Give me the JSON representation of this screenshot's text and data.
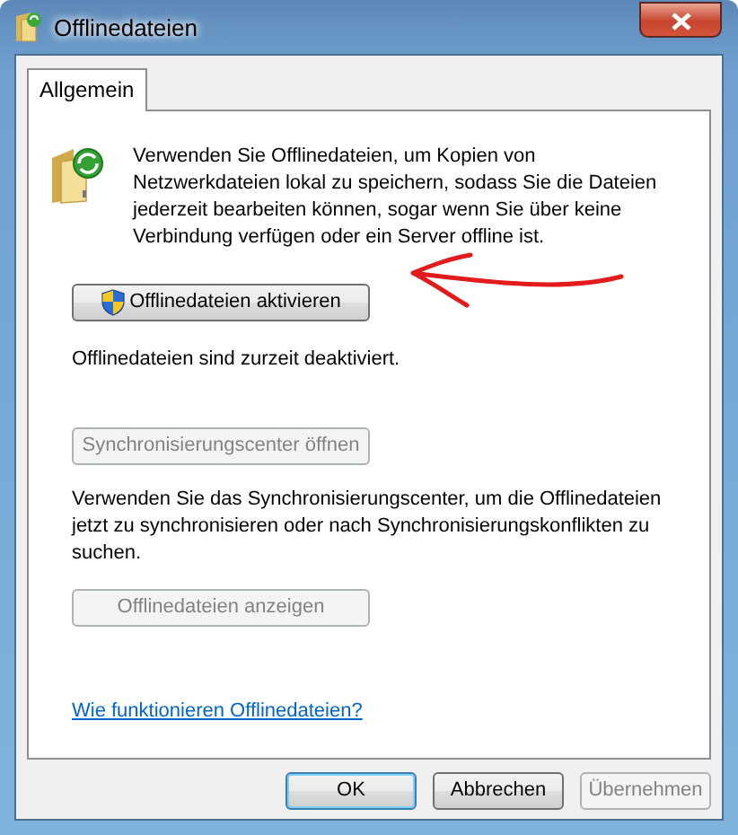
{
  "window": {
    "title": "Offlinedateien"
  },
  "tabs": [
    {
      "label": "Allgemein",
      "selected": true
    }
  ],
  "panel": {
    "intro": "Verwenden Sie Offlinedateien, um Kopien von Netzwerkdateien lokal zu speichern, sodass Sie die Dateien jederzeit bearbeiten können, sogar wenn Sie über keine Verbindung verfügen oder ein Server offline ist.",
    "items": [
      {
        "kind": "button",
        "label": "Offlinedateien aktivieren",
        "disabled": false,
        "shield": true
      },
      {
        "kind": "text",
        "text": "Offlinedateien sind zurzeit deaktiviert."
      },
      {
        "kind": "button",
        "label": "Synchronisierungscenter öffnen",
        "disabled": true
      },
      {
        "kind": "text",
        "text": "Verwenden Sie das Synchronisierungscenter, um die Offlinedateien jetzt zu synchronisieren oder nach Synchronisierungskonflikten zu suchen."
      },
      {
        "kind": "button",
        "label": "Offlinedateien anzeigen",
        "disabled": true
      },
      {
        "kind": "link",
        "text": "Wie funktionieren Offlinedateien?"
      }
    ]
  },
  "footer": [
    {
      "label": "OK",
      "disabled": false,
      "default": true
    },
    {
      "label": "Abbrechen",
      "disabled": false,
      "default": false
    },
    {
      "label": "Übernehmen",
      "disabled": true,
      "default": false
    }
  ]
}
